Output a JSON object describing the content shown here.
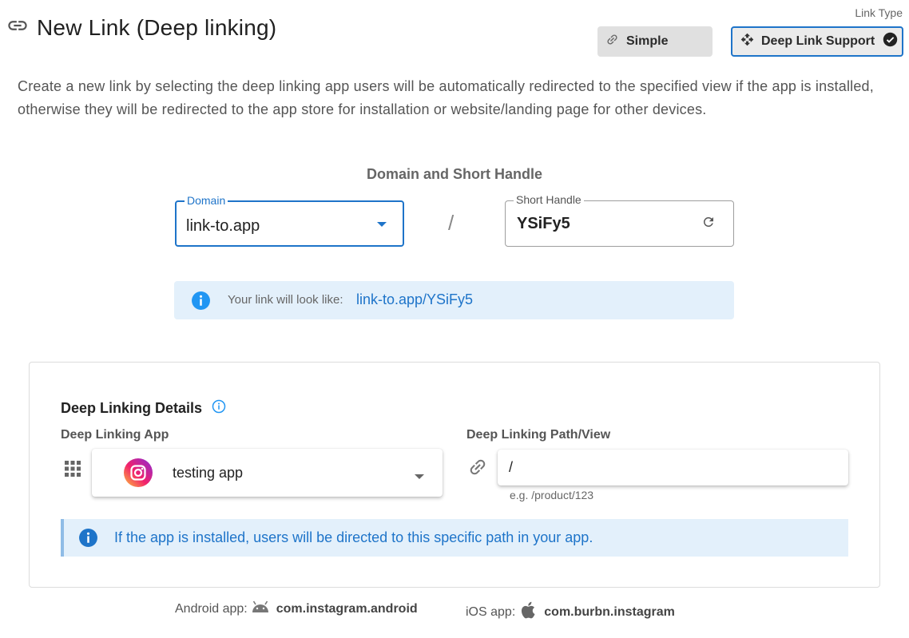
{
  "header": {
    "title": "New Link (Deep linking)"
  },
  "link_type": {
    "label": "Link Type",
    "options": [
      {
        "label": "Simple",
        "selected": false
      },
      {
        "label": "Deep Link Support",
        "selected": true
      }
    ]
  },
  "description": "Create a new link by selecting the deep linking app users will be automatically redirected to the specified view if the app is installed, otherwise they will be redirected to the app store for installation or website/landing page for other devices.",
  "domain_section": {
    "title": "Domain and Short Handle",
    "domain": {
      "label": "Domain",
      "value": "link-to.app"
    },
    "separator": "/",
    "short_handle": {
      "label": "Short Handle",
      "value": "YSiFy5"
    },
    "preview": {
      "message": "Your link will look like:",
      "link": "link-to.app/YSiFy5"
    }
  },
  "deep_linking": {
    "title": "Deep Linking Details",
    "app": {
      "label": "Deep Linking App",
      "value": "testing app",
      "icon": "instagram-icon"
    },
    "path": {
      "label": "Deep Linking Path/View",
      "value": "/",
      "hint": "e.g. /product/123"
    },
    "info": "If the app is installed, users will be directed to this specific path in your app."
  },
  "footer": {
    "android": {
      "label": "Android app:",
      "package": "com.instagram.android"
    },
    "ios": {
      "label": "iOS app:",
      "package": "com.burbn.instagram"
    }
  },
  "colors": {
    "accent": "#1e74c9",
    "info_bg": "#e3f0fb"
  }
}
